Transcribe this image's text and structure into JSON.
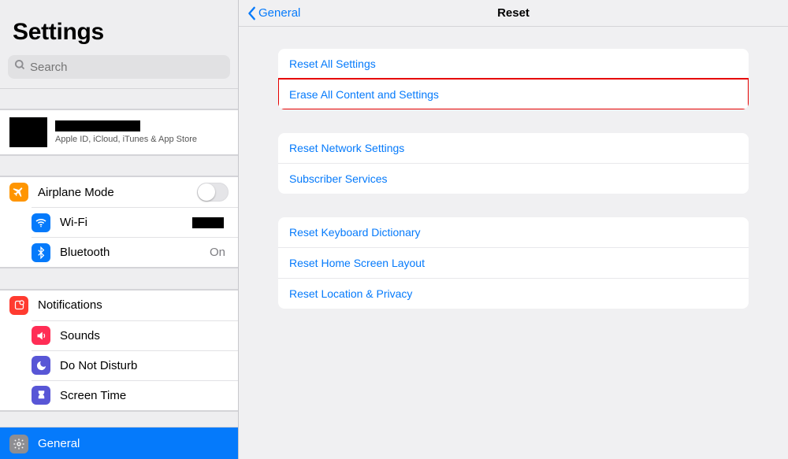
{
  "sidebar": {
    "title": "Settings",
    "search_placeholder": "Search",
    "account_sub": "Apple ID, iCloud, iTunes & App Store",
    "group1": {
      "airplane": "Airplane Mode",
      "wifi": "Wi-Fi",
      "bluetooth": "Bluetooth",
      "bluetooth_value": "On"
    },
    "group2": {
      "notifications": "Notifications",
      "sounds": "Sounds",
      "dnd": "Do Not Disturb",
      "screentime": "Screen Time"
    },
    "selected": {
      "general": "General"
    }
  },
  "nav": {
    "back": "General",
    "title": "Reset"
  },
  "reset": {
    "g1": {
      "all_settings": "Reset All Settings",
      "erase_all": "Erase All Content and Settings"
    },
    "g2": {
      "network": "Reset Network Settings",
      "subscriber": "Subscriber Services"
    },
    "g3": {
      "keyboard": "Reset Keyboard Dictionary",
      "home": "Reset Home Screen Layout",
      "location": "Reset Location & Privacy"
    }
  },
  "colors": {
    "airplane": "#ff9500",
    "wifi": "#057afb",
    "bluetooth": "#057afb",
    "notifications": "#ff3b30",
    "sounds": "#ff2d55",
    "dnd": "#5856d6",
    "screentime": "#5856d6",
    "general": "#8e8e92"
  }
}
